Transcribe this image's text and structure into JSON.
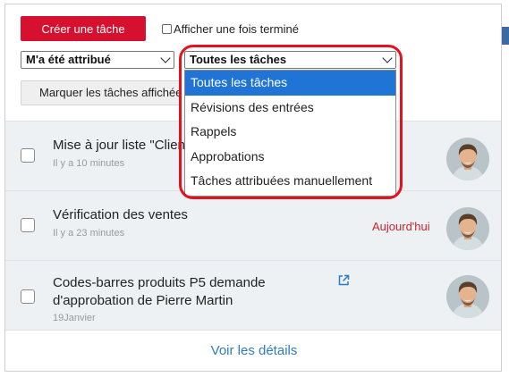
{
  "toolbar": {
    "create_label": "Créer une tâche",
    "show_done_label": "Afficher une fois terminé",
    "assigned_filter": "M'a été attribué",
    "task_filter": "Toutes les tâches",
    "mark_label": "Marquer les tâches affichées"
  },
  "dropdown": {
    "options": [
      "Toutes les tâches",
      "Révisions des entrées",
      "Rappels",
      "Approbations",
      "Tâches attribuées manuellement"
    ],
    "selected": "Toutes les tâches"
  },
  "tasks": [
    {
      "title": "Mise à jour liste \"Clients\"",
      "time": "Il y a 10 minutes",
      "due": ""
    },
    {
      "title": "Vérification des ventes",
      "time": "Il y a 23 minutes",
      "due": "Aujourd'hui"
    },
    {
      "title_line1": "Codes-barres produits P5 demande",
      "title_line2": "d'approbation de Pierre Martin",
      "time": "19Janvier",
      "due": ""
    }
  ],
  "footer": {
    "details_label": "Voir les détails"
  },
  "colors": {
    "primary": "#d6102f",
    "selected_option": "#1f74d5",
    "link": "#2d7dbe",
    "due": "#c8262e",
    "highlight": "#e3121e"
  }
}
